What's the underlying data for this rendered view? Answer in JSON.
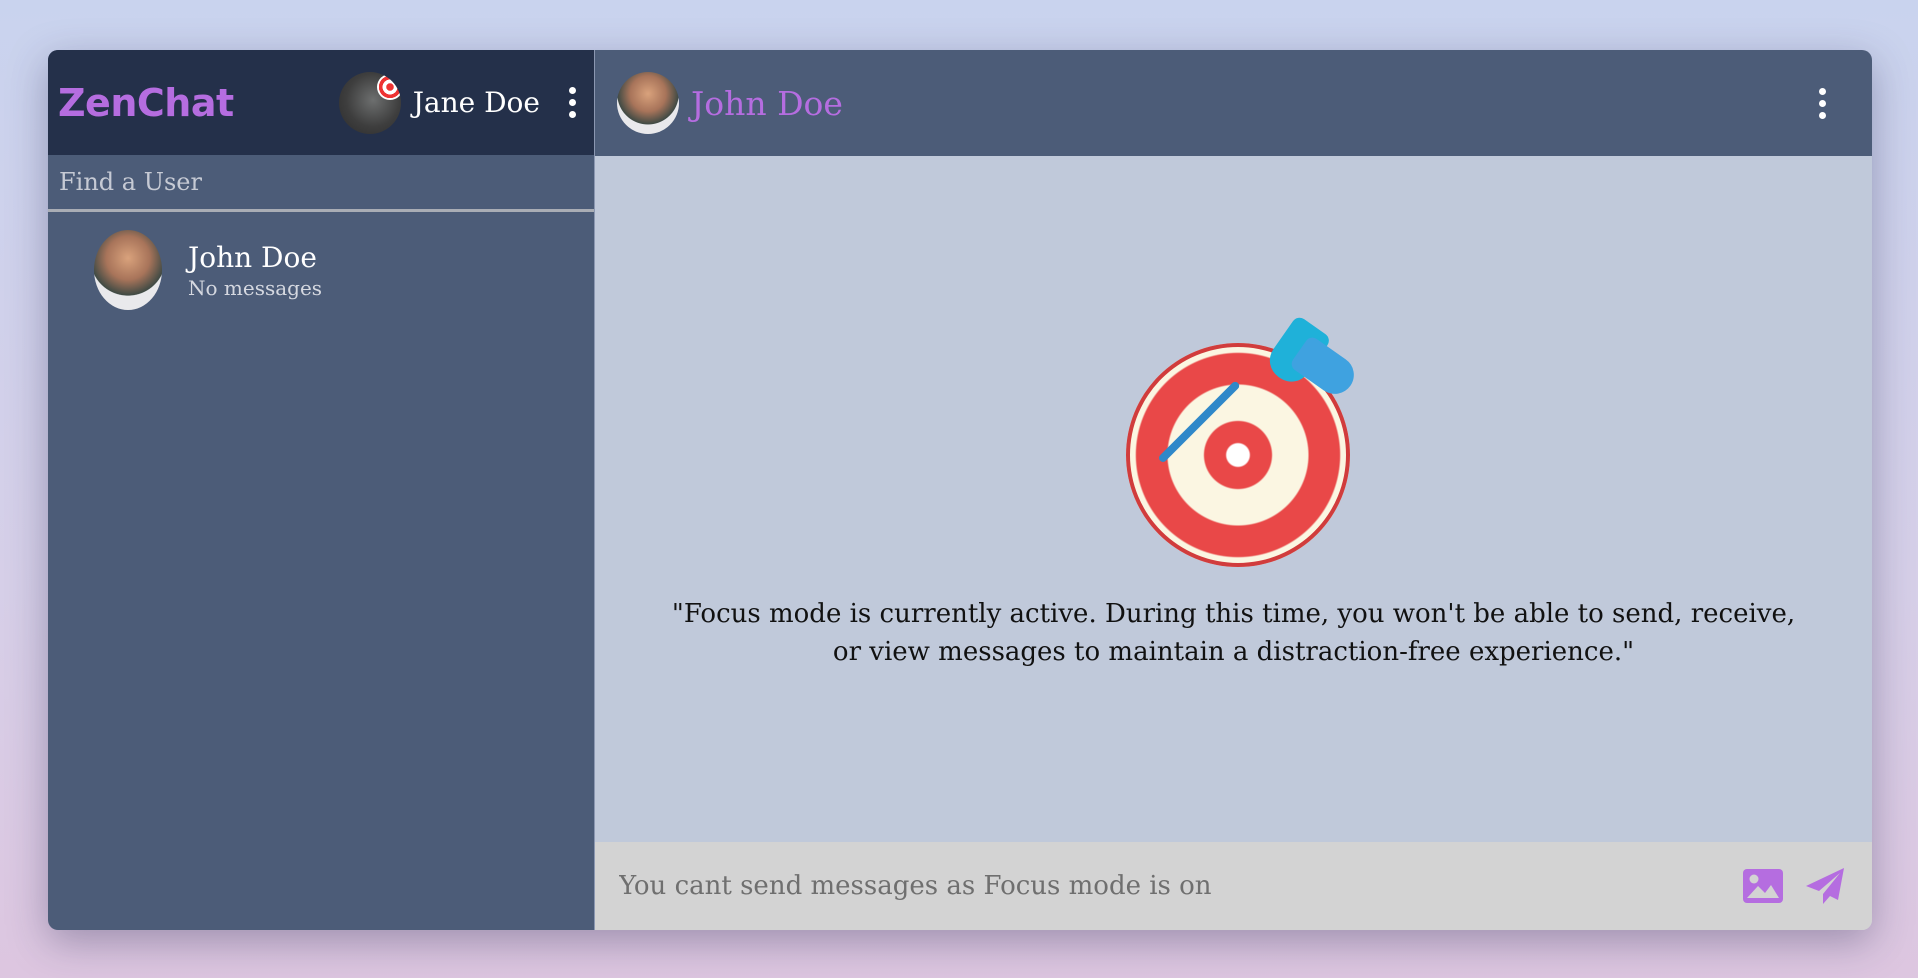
{
  "app": {
    "brand": "ZenChat"
  },
  "current_user": {
    "name": "Jane Doe"
  },
  "search": {
    "placeholder": "Find a User"
  },
  "contacts": [
    {
      "name": "John Doe",
      "last_message": "No messages"
    }
  ],
  "chat": {
    "peer_name": "John Doe",
    "focus_message": "\"Focus mode is currently active. During this time, you won't be able to send, receive, or view messages to maintain a distraction-free experience.\"",
    "composer_placeholder": "You cant send messages as Focus mode is on"
  },
  "icons": {
    "menu": "kebab-menu-icon",
    "image": "image-icon",
    "send": "send-icon",
    "focus": "target-dart-icon"
  },
  "colors": {
    "accent": "#b56de0",
    "sidebar_header": "#24304a",
    "sidebar": "#4c5c78",
    "chat_bg": "#c0c9da",
    "composer_bg": "#d3d3d3"
  }
}
